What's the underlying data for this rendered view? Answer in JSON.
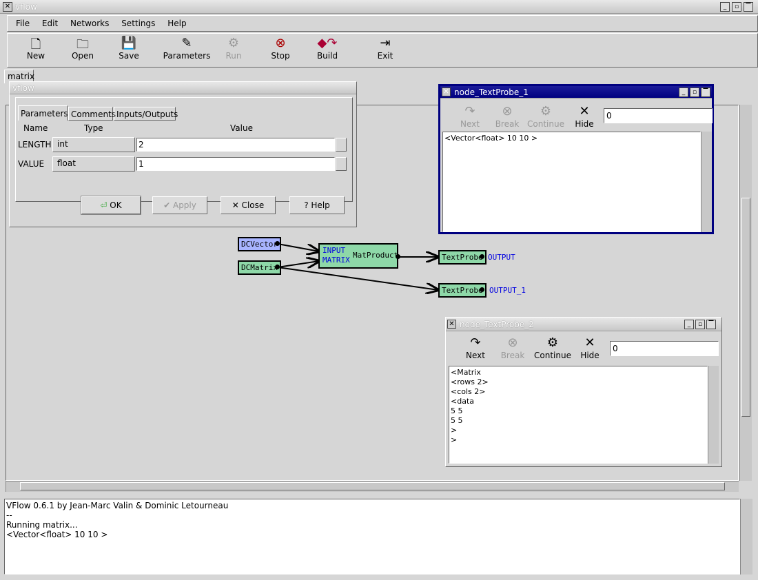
{
  "window": {
    "title": "vflow"
  },
  "menu": [
    "File",
    "Edit",
    "Networks",
    "Settings",
    "Help"
  ],
  "toolbar": [
    {
      "label": "New",
      "icon": "new-file-icon",
      "enabled": true
    },
    {
      "label": "Open",
      "icon": "folder-icon",
      "enabled": true
    },
    {
      "label": "Save",
      "icon": "floppy-icon",
      "enabled": true
    },
    {
      "label": "Parameters",
      "icon": "pencil-paper-icon",
      "enabled": true
    },
    {
      "label": "Run",
      "icon": "gears-icon",
      "enabled": false
    },
    {
      "label": "Stop",
      "icon": "stop-icon",
      "enabled": true
    },
    {
      "label": "Build",
      "icon": "build-icon",
      "enabled": true
    },
    {
      "label": "Exit",
      "icon": "exit-icon",
      "enabled": true
    }
  ],
  "doc_tab": "matrix",
  "param_dialog": {
    "title": "vflow",
    "tabs": [
      "Parameters",
      "Comments",
      "Inputs/Outputs"
    ],
    "headers": [
      "Name",
      "Type",
      "Value"
    ],
    "rows": [
      {
        "name": "LENGTH",
        "type": "int",
        "value": "2"
      },
      {
        "name": "VALUE",
        "type": "float",
        "value": "1"
      }
    ],
    "buttons": {
      "ok": "OK",
      "apply": "Apply",
      "close": "Close",
      "help": "Help"
    }
  },
  "network": {
    "nodes": {
      "dcvector": "DCVector",
      "dcmatrix": "DCMatrix",
      "matproduct": "MatProduct",
      "input": "INPUT",
      "matrix": "MATRIX",
      "probe1": "TextProbe",
      "probe2": "TextProbe"
    },
    "outputs": {
      "out": "OUTPUT",
      "out1": "OUTPUT_1"
    }
  },
  "probe1": {
    "title": "node_TextProbe_1",
    "buttons": [
      "Next",
      "Break",
      "Continue",
      "Hide"
    ],
    "field": "0",
    "text": "<Vector<float> 10 10 >"
  },
  "probe2": {
    "title": "node_TextProbe_2",
    "buttons": [
      "Next",
      "Break",
      "Continue",
      "Hide"
    ],
    "field": "0",
    "text": "<Matrix\n<rows 2>\n<cols 2>\n<data\n5 5\n5 5\n>\n>"
  },
  "console": {
    "text": "VFlow 0.6.1 by Jean-Marc Valin & Dominic Letourneau\n--\nRunning matrix...\n<Vector<float> 10 10 >"
  }
}
